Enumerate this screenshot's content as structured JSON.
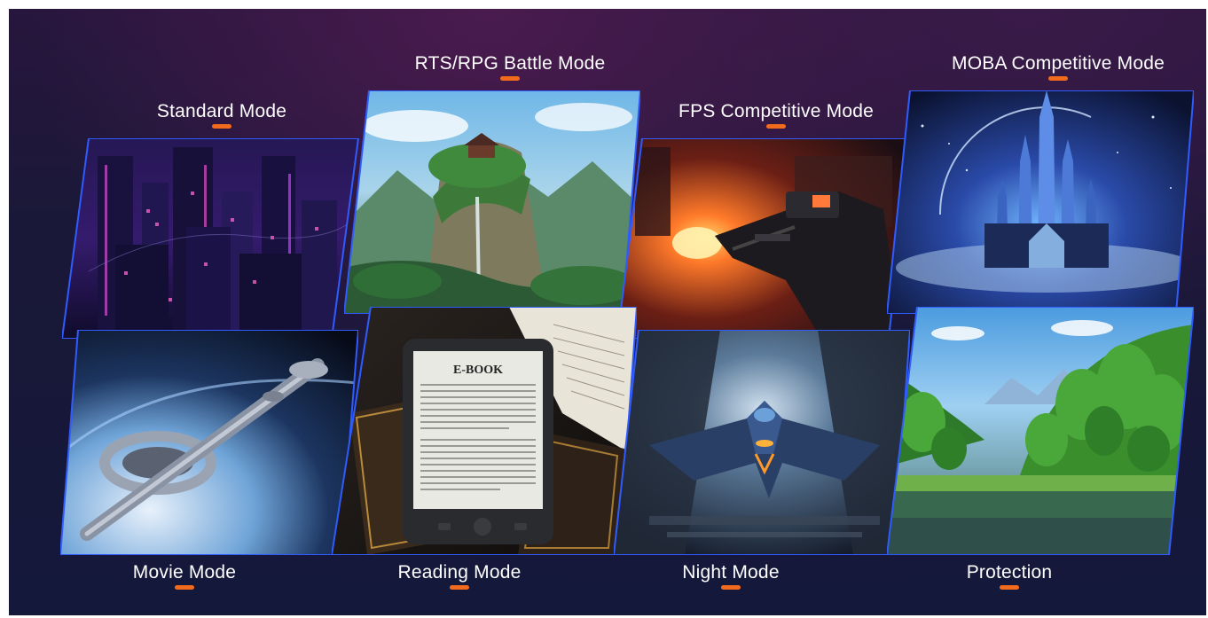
{
  "modes": [
    {
      "id": "standard",
      "label": "Standard Mode"
    },
    {
      "id": "rts",
      "label": "RTS/RPG Battle Mode"
    },
    {
      "id": "fps",
      "label": "FPS Competitive Mode"
    },
    {
      "id": "moba",
      "label": "MOBA Competitive Mode"
    },
    {
      "id": "movie",
      "label": "Movie Mode"
    },
    {
      "id": "reading",
      "label": "Reading Mode"
    },
    {
      "id": "night",
      "label": "Night Mode"
    },
    {
      "id": "protection",
      "label": "Protection"
    }
  ],
  "ebook": {
    "title": "E-BOOK"
  },
  "colors": {
    "accent": "#f26a1b",
    "frame_border": "#2f5bff",
    "background": "#1a1838"
  }
}
